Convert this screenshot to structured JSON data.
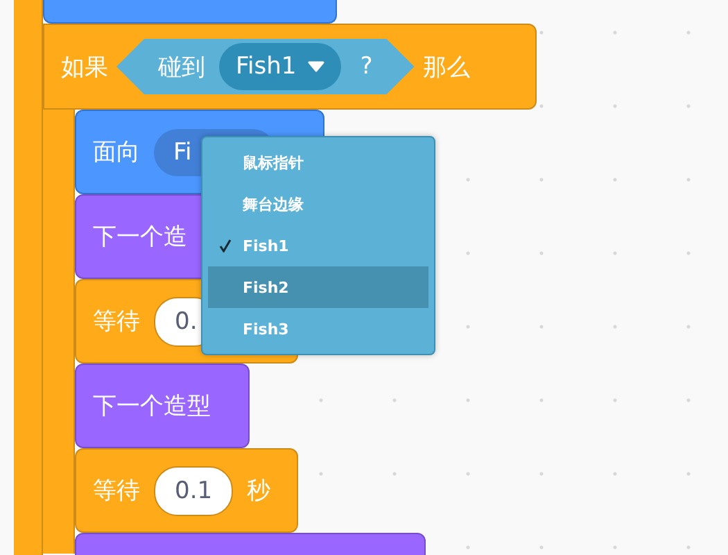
{
  "if_block": {
    "label": "如果",
    "condition": {
      "label": "碰到",
      "dropdown": "Fish1",
      "suffix": "?"
    },
    "then_label": "那么"
  },
  "inner_blocks": [
    {
      "kind": "motion",
      "label": "面向",
      "input": "Fi"
    },
    {
      "kind": "looks",
      "label": "下一个造"
    },
    {
      "kind": "control",
      "label": "等待",
      "input": "0."
    },
    {
      "kind": "looks",
      "label": "下一个造型"
    },
    {
      "kind": "control",
      "label": "等待",
      "input": "0.1",
      "suffix": "秒"
    },
    {
      "kind": "looks"
    }
  ],
  "dropdown_menu": {
    "items": [
      {
        "label": "鼠标指针",
        "checked": false,
        "selected": false
      },
      {
        "label": "舞台边缘",
        "checked": false,
        "selected": false
      },
      {
        "label": "Fish1",
        "checked": true,
        "selected": false
      },
      {
        "label": "Fish2",
        "checked": false,
        "selected": true
      },
      {
        "label": "Fish3",
        "checked": false,
        "selected": false
      }
    ]
  }
}
